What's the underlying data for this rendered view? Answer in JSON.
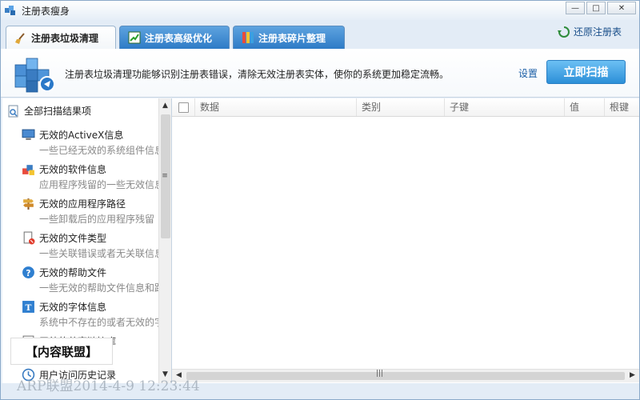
{
  "window": {
    "title": "注册表瘦身",
    "minimize": "—",
    "maximize": "□",
    "close": "✕"
  },
  "tabs": [
    {
      "label": "注册表垃圾清理",
      "active": true
    },
    {
      "label": "注册表高级优化",
      "active": false
    },
    {
      "label": "注册表碎片整理",
      "active": false
    }
  ],
  "restore_label": "还原注册表",
  "banner": {
    "description": "注册表垃圾清理功能够识别注册表错误，清除无效注册表实体，使你的系统更加稳定流畅。",
    "settings_label": "设置",
    "scan_button": "立即扫描"
  },
  "tree": {
    "root": "全部扫描结果项",
    "items": [
      {
        "title": "无效的ActiveX信息",
        "subtitle": "一些已经无效的系统组件信息",
        "icon": "monitor-icon"
      },
      {
        "title": "无效的软件信息",
        "subtitle": "应用程序残留的一些无效信息",
        "icon": "software-icon"
      },
      {
        "title": "无效的应用程序路径",
        "subtitle": "一些卸载后的应用程序残留",
        "icon": "signpost-icon"
      },
      {
        "title": "无效的文件类型",
        "subtitle": "一些关联错误或者无关联信息",
        "icon": "file-error-icon"
      },
      {
        "title": "无效的帮助文件",
        "subtitle": "一些无效的帮助文件信息和路径",
        "icon": "help-icon"
      },
      {
        "title": "无效的字体信息",
        "subtitle": "系统中不存在的或者无效的字体",
        "icon": "font-icon"
      },
      {
        "title": "无效的共享链接库",
        "subtitle": "一些丢失的共享",
        "icon": "share-icon"
      },
      {
        "title": "用户访问历史记录",
        "subtitle": "",
        "icon": "history-icon"
      }
    ]
  },
  "table": {
    "columns": [
      "数据",
      "类别",
      "子键",
      "值",
      "根键"
    ]
  },
  "overlay": {
    "box_text": "【内容联盟】",
    "stamp_text": "ARP联盟2014-4-9 12:23:44"
  }
}
